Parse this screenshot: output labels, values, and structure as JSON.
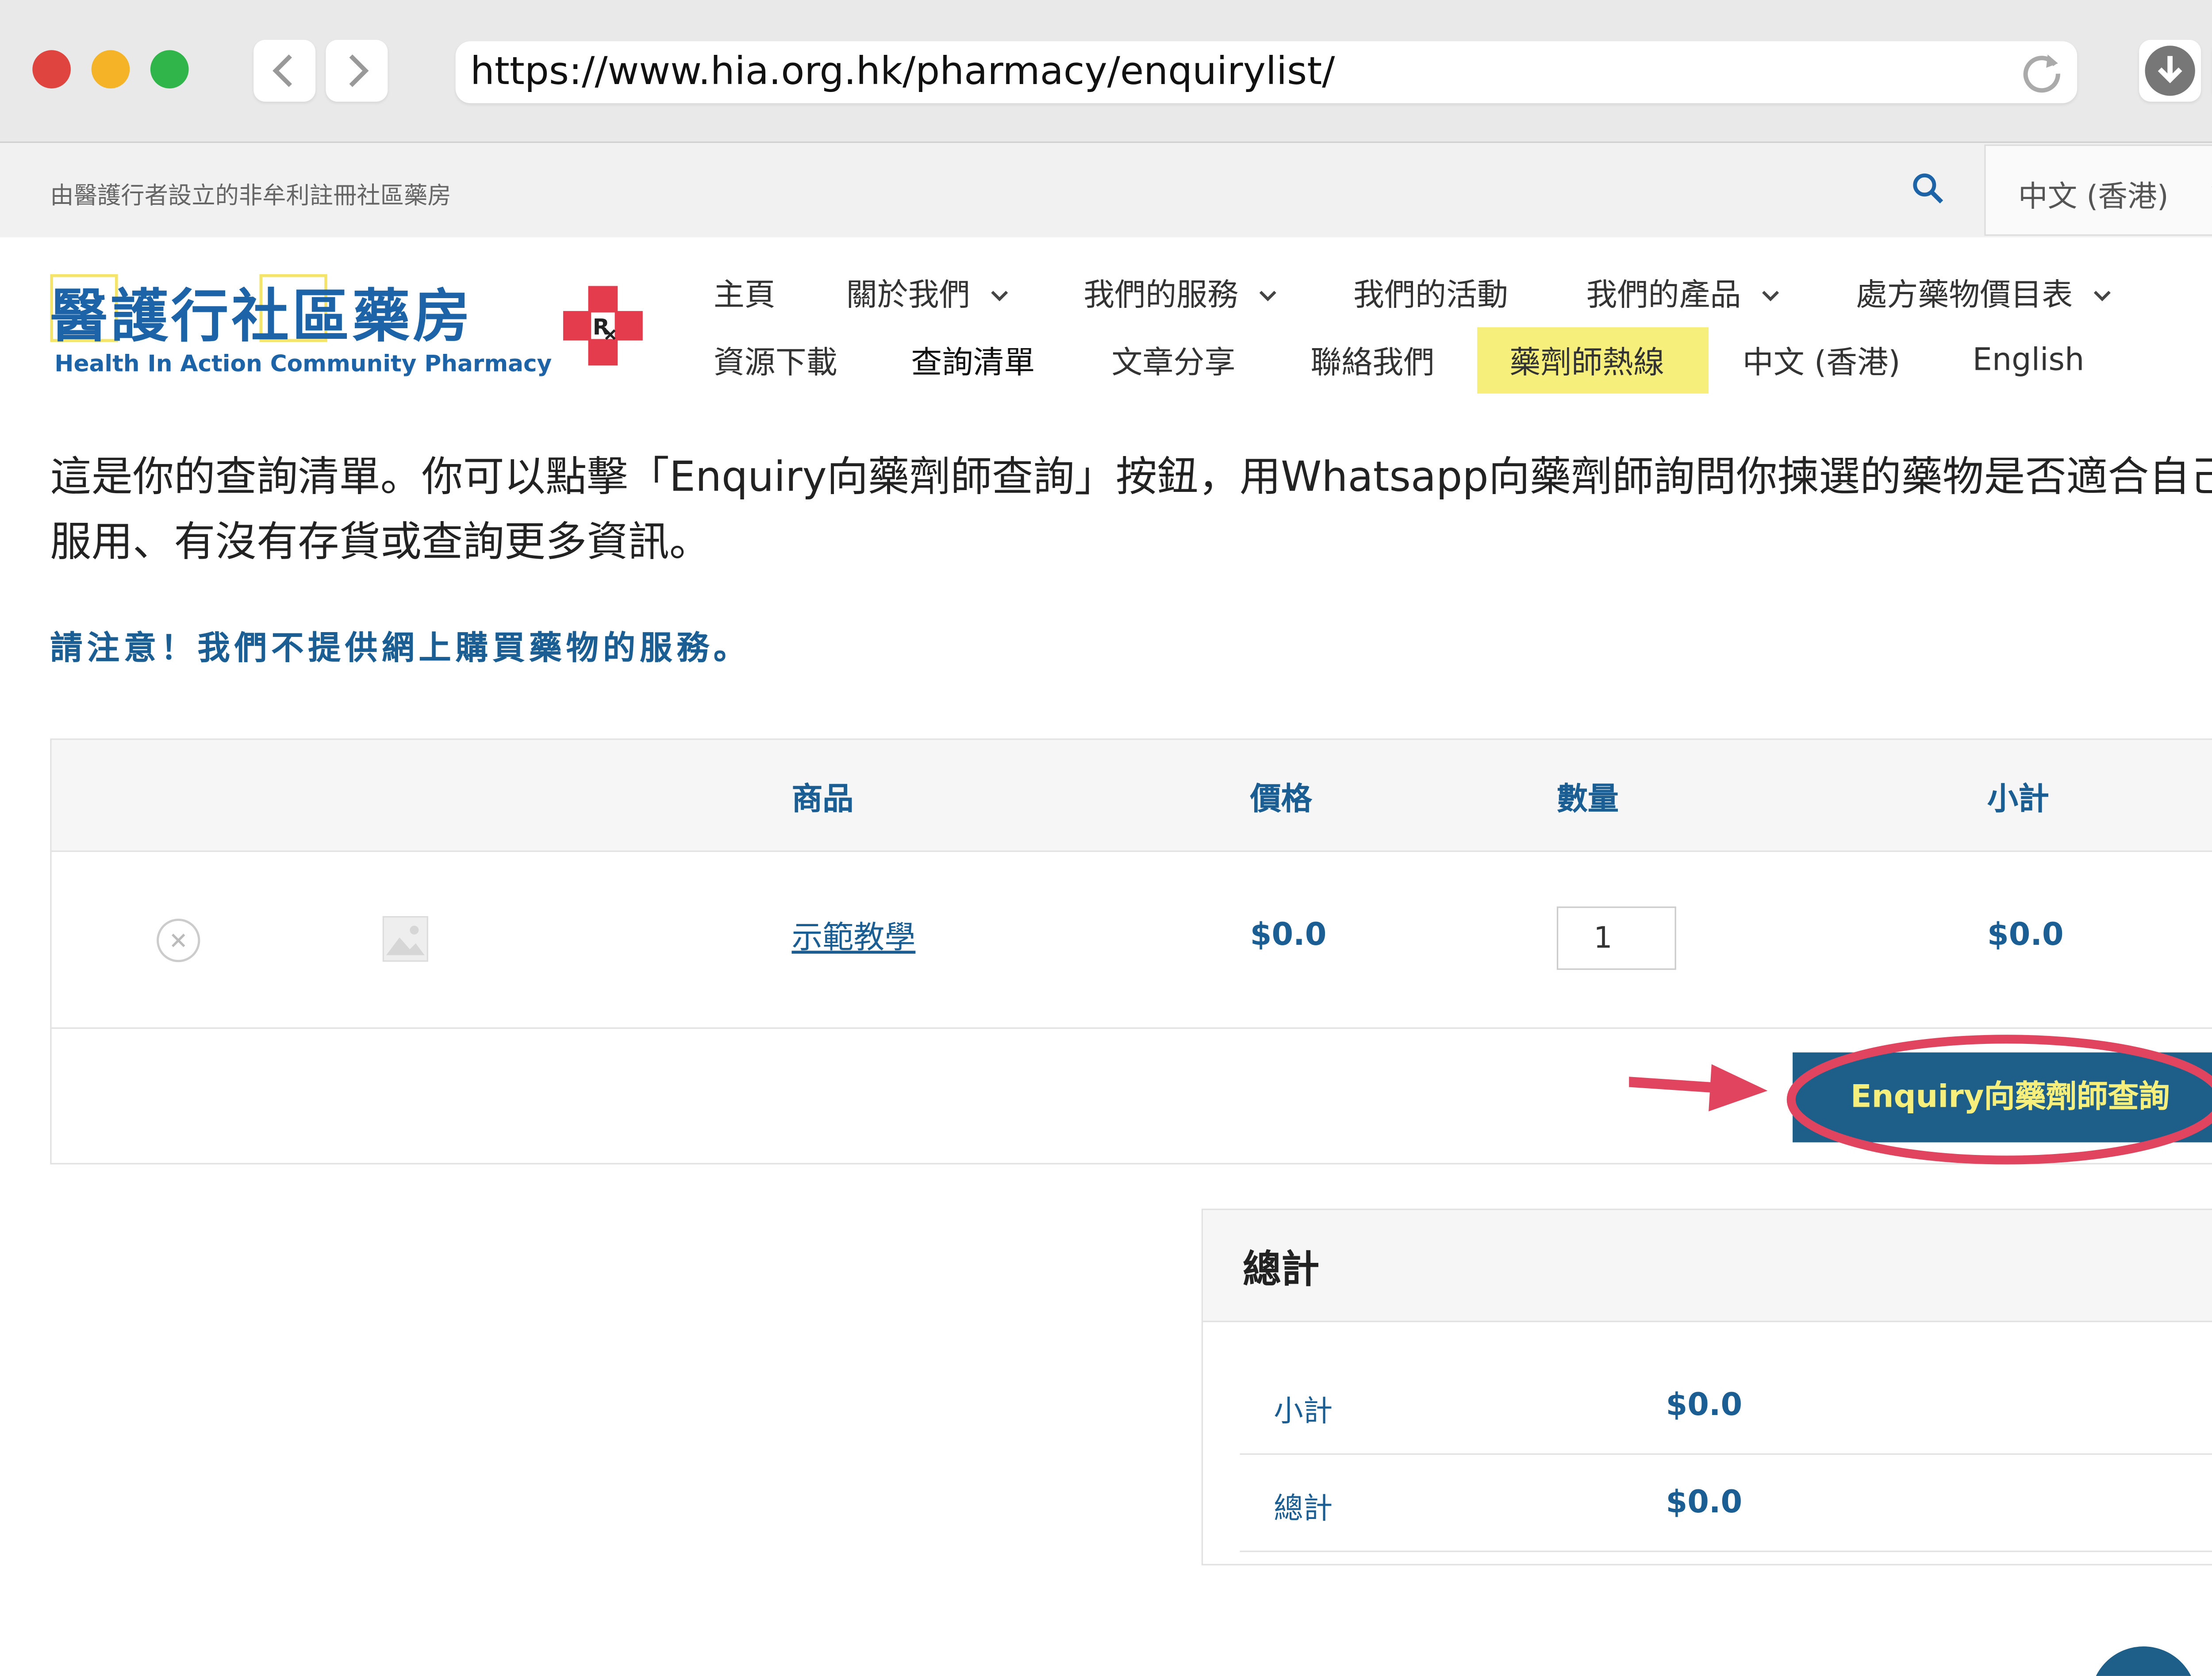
{
  "browser": {
    "url": "https://www.hia.org.hk/pharmacy/enquirylist/",
    "traffic_colors": [
      "#e0443e",
      "#f5b428",
      "#2fb54a"
    ]
  },
  "topbar": {
    "tagline": "由醫護行者設立的非牟利註冊社區藥房",
    "language_selector": "中文 (香港)"
  },
  "logo": {
    "name_cn": "醫護行社區藥房",
    "name_en": "Health In Action Community Pharmacy"
  },
  "nav": {
    "row1": [
      "主頁",
      "關於我們",
      "我們的服務",
      "我們的活動",
      "我們的產品",
      "處方藥物價目表"
    ],
    "row2": [
      "資源下載",
      "查詢清單",
      "文章分享",
      "聯絡我們",
      "藥劑師熱線",
      "中文 (香港)",
      "English"
    ],
    "highlight": "藥劑師熱線",
    "highlight_color": "#f6ef7c"
  },
  "intro": "這是你的查詢清單。你可以點擊「Enquiry向藥劑師查詢」按鈕，用Whatsapp向藥劑師詢問你揀選的藥物是否適合自己服用、有沒有存貨或查詢更多資訊。",
  "notice": "請注意！我們不提供網上購買藥物的服務。",
  "table": {
    "headers": [
      "商品",
      "價格",
      "數量",
      "小計"
    ],
    "rows": [
      {
        "product": "示範教學",
        "price": "$0.0",
        "quantity": "1",
        "subtotal": "$0.0"
      }
    ],
    "enquiry_button": "Enquiry向藥劑師查詢"
  },
  "totals": {
    "title": "總計",
    "subtotal_label": "小計",
    "subtotal_value": "$0.0",
    "total_label": "總計",
    "total_value": "$0.0"
  },
  "colors": {
    "brand_blue": "#1b5e93",
    "button_bg": "#1d5f88",
    "button_text": "#f6ef7c",
    "annotation_red": "#e0445e"
  }
}
